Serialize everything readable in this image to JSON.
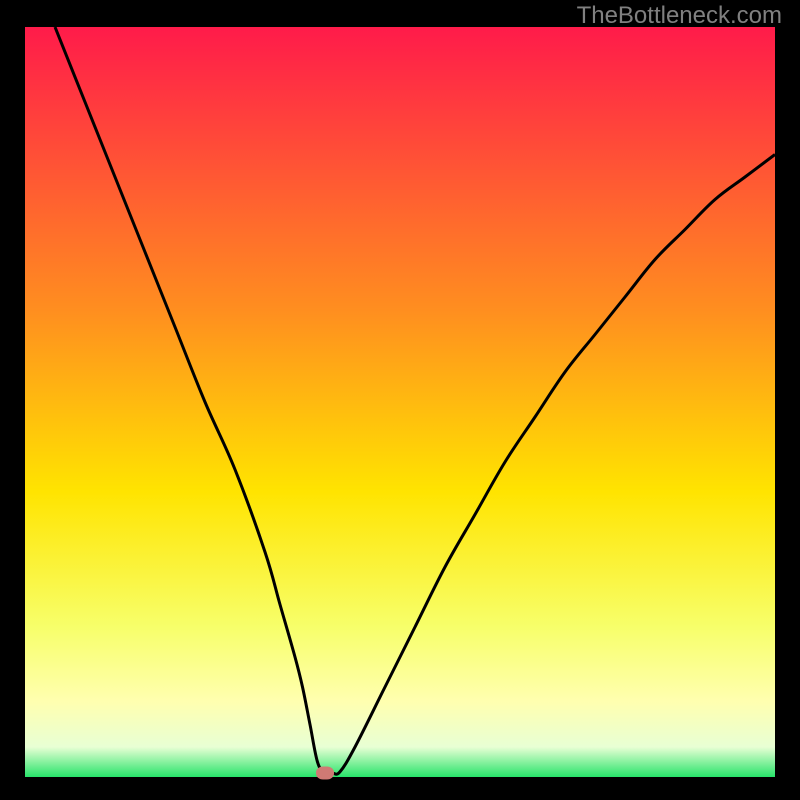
{
  "attribution": "TheBottleneck.com",
  "colors": {
    "bg_black": "#000000",
    "attribution_text": "#808080",
    "curve": "#000000",
    "marker": "#cf7a74",
    "gradient_top": "#ff1b4a",
    "gradient_mid_upper": "#ff8f1f",
    "gradient_mid": "#ffe400",
    "gradient_mid_lower": "#f7ff6a",
    "gradient_yellow_white": "#ffffb0",
    "gradient_pale": "#e8ffd4",
    "gradient_green": "#27e46a"
  },
  "chart_data": {
    "type": "line",
    "title": "",
    "xlabel": "",
    "ylabel": "",
    "xlim": [
      0,
      100
    ],
    "ylim": [
      0,
      100
    ],
    "series": [
      {
        "name": "bottleneck-curve",
        "x": [
          4,
          8,
          12,
          16,
          20,
          24,
          28,
          32,
          34,
          36,
          37,
          38,
          39,
          40,
          41,
          42,
          44,
          48,
          52,
          56,
          60,
          64,
          68,
          72,
          76,
          80,
          84,
          88,
          92,
          96,
          100
        ],
        "values": [
          100,
          90,
          80,
          70,
          60,
          50,
          41,
          30,
          23,
          16,
          12,
          7,
          2,
          0.5,
          0.5,
          0.7,
          4,
          12,
          20,
          28,
          35,
          42,
          48,
          54,
          59,
          64,
          69,
          73,
          77,
          80,
          83
        ]
      }
    ],
    "marker": {
      "x": 40,
      "y": 0.5
    },
    "gradient_stops": [
      {
        "pct": 0,
        "color": "#ff1b4a"
      },
      {
        "pct": 38,
        "color": "#ff8f1f"
      },
      {
        "pct": 62,
        "color": "#ffe400"
      },
      {
        "pct": 80,
        "color": "#f7ff6a"
      },
      {
        "pct": 90,
        "color": "#ffffb0"
      },
      {
        "pct": 96,
        "color": "#e8ffd4"
      },
      {
        "pct": 100,
        "color": "#27e46a"
      }
    ]
  }
}
